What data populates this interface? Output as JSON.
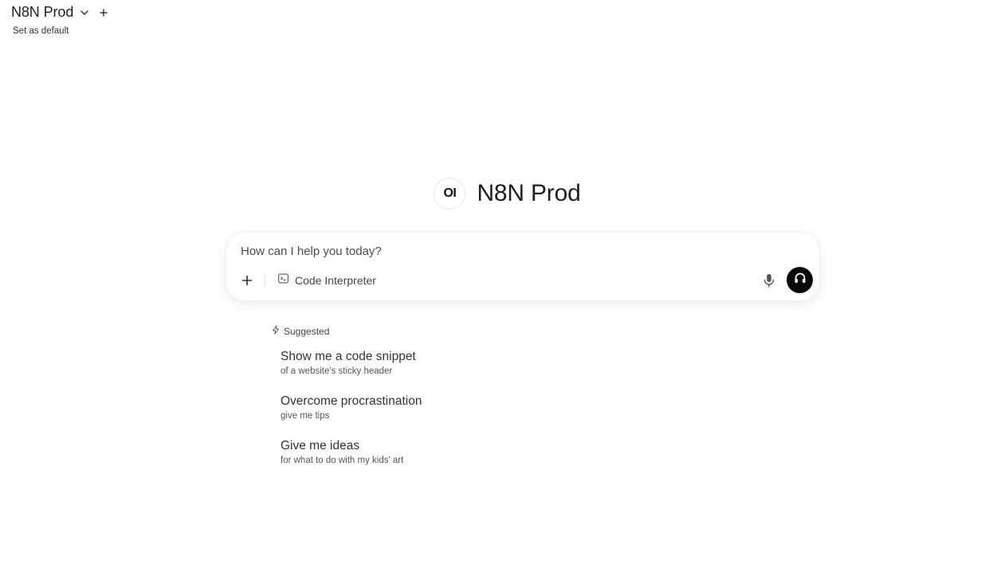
{
  "header": {
    "model_name": "N8N Prod",
    "set_default_label": "Set as default"
  },
  "hero": {
    "logo_text": "OI",
    "title": "N8N Prod"
  },
  "composer": {
    "placeholder": "How can I help you today?",
    "tool_label": "Code Interpreter"
  },
  "suggested": {
    "heading": "Suggested",
    "items": [
      {
        "title": "Show me a code snippet",
        "subtitle": "of a website's sticky header"
      },
      {
        "title": "Overcome procrastination",
        "subtitle": "give me tips"
      },
      {
        "title": "Give me ideas",
        "subtitle": "for what to do with my kids' art"
      }
    ]
  },
  "icons": {
    "model_dropdown": "chevron-down-icon",
    "new_chat": "plus-icon",
    "attach": "plus-icon",
    "code_interpreter": "terminal-icon",
    "microphone": "microphone-icon",
    "voice_mode": "headphones-icon",
    "suggested": "lightning-icon"
  },
  "colors": {
    "voice_button_bg": "#0a0a0a",
    "text_primary": "#1f1f1f"
  }
}
